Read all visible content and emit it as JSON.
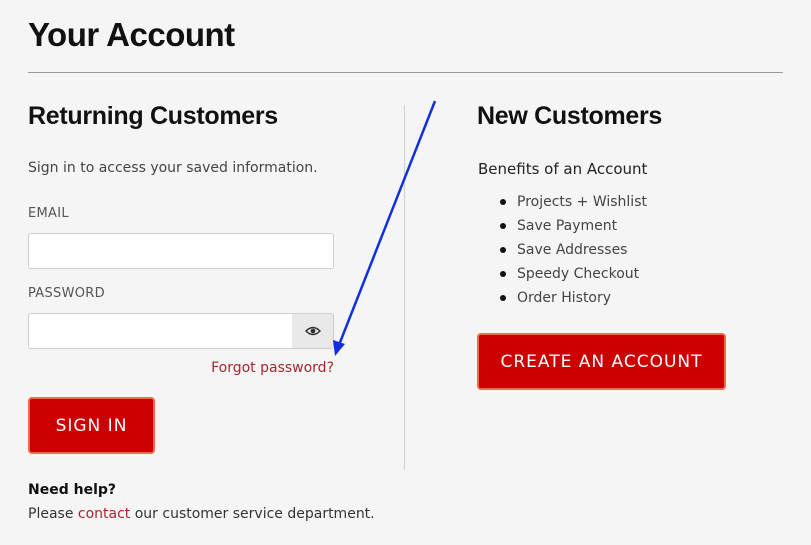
{
  "page": {
    "title": "Your Account"
  },
  "returning": {
    "heading": "Returning Customers",
    "intro": "Sign in to access your saved information.",
    "email_label": "EMAIL",
    "email_value": "",
    "password_label": "PASSWORD",
    "password_value": "",
    "forgot_link": "Forgot password?",
    "signin_label": "SIGN IN"
  },
  "help": {
    "heading": "Need help?",
    "prefix": "Please ",
    "link": "contact",
    "suffix": " our customer service department."
  },
  "new_customers": {
    "heading": "New Customers",
    "benefits_title": "Benefits of an Account",
    "benefits": [
      "Projects + Wishlist",
      "Save Payment",
      "Save Addresses",
      "Speedy Checkout",
      "Order History"
    ],
    "create_label": "CREATE AN ACCOUNT"
  },
  "icons": {
    "password_toggle": "eye-icon"
  },
  "colors": {
    "accent_red": "#cc0000",
    "button_border": "#f26a4b",
    "link": "#a3272b",
    "annotation_arrow": "#1030e0"
  }
}
